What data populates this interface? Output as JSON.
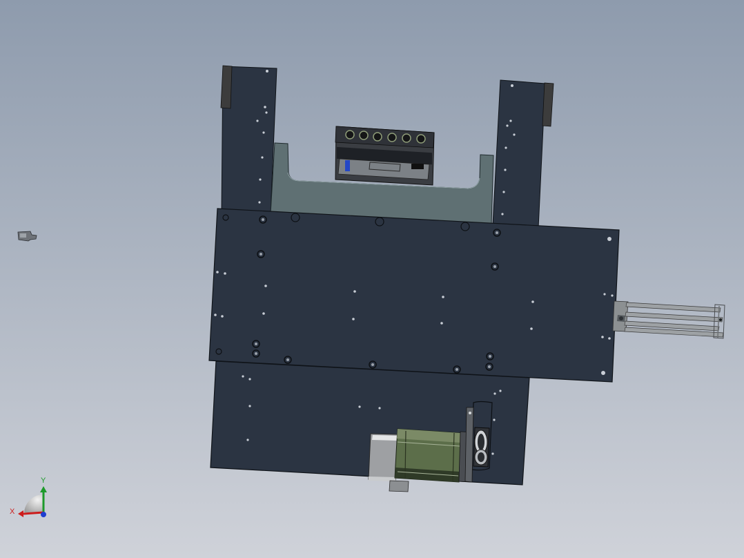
{
  "viewport": {
    "background_top": "#8e9bad",
    "background_bottom": "#cfd2d9"
  },
  "colors": {
    "plate": "#2b3442",
    "plate_edge": "#0f1318",
    "cover": "#5f7073",
    "hole": "#c9ced6",
    "motor": "#5c6e4a",
    "steel": "#8c9092",
    "bumper": "#3c3c3c"
  },
  "triad": {
    "x_label": "X",
    "y_label": "Y",
    "x_color": "#cc1d1d",
    "y_color": "#1d9a2a",
    "z_color": "#1f3fd0"
  }
}
